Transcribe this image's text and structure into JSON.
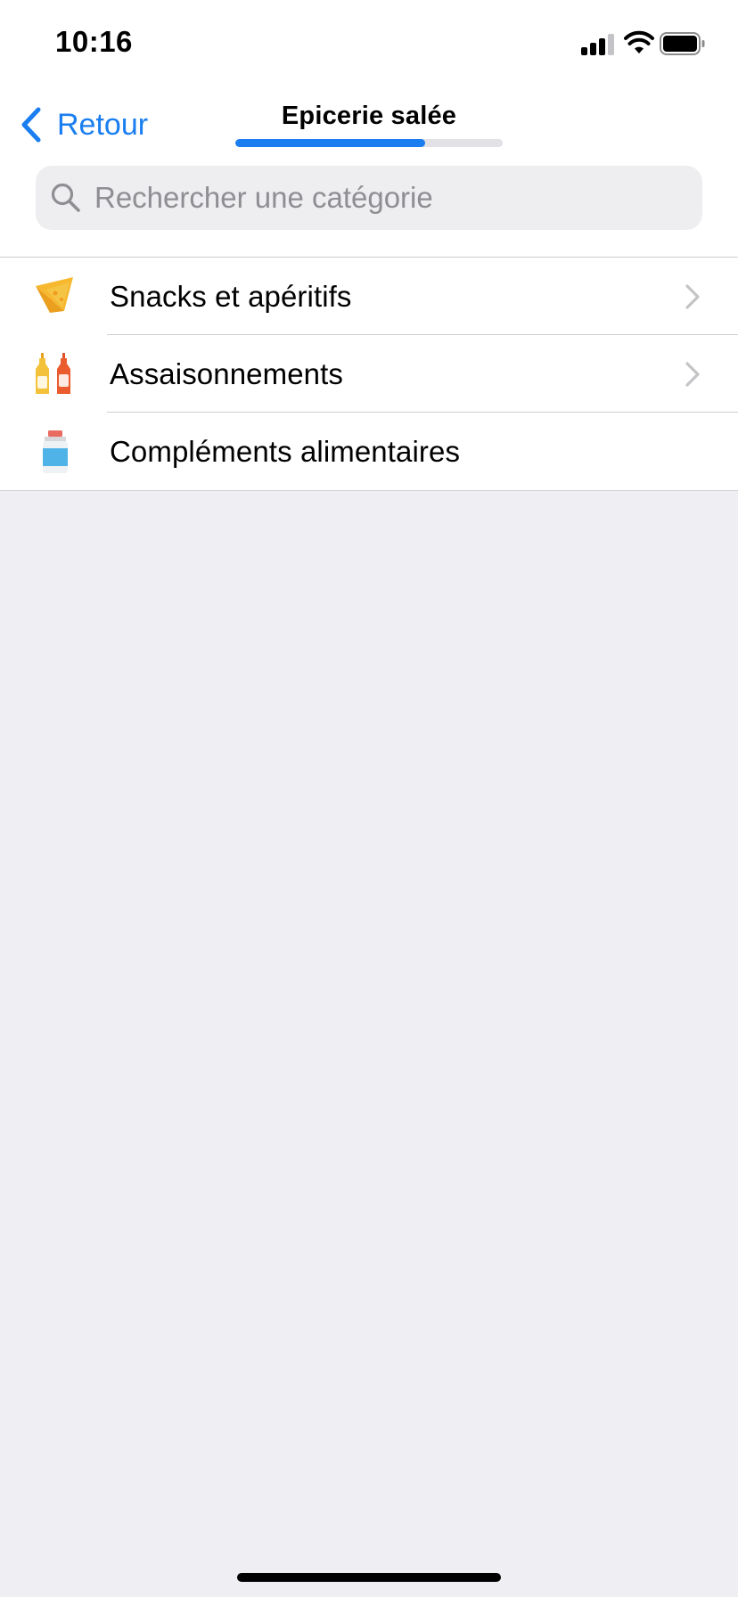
{
  "status_bar": {
    "time": "10:16",
    "icons": [
      "cellular-signal-icon",
      "wifi-icon",
      "battery-icon"
    ]
  },
  "nav": {
    "back_label": "Retour",
    "back_icon": "chevron-left-icon",
    "title": "Epicerie salée",
    "progress_fraction": 0.71
  },
  "search": {
    "placeholder": "Rechercher une catégorie",
    "value": "",
    "icon": "magnifying-glass-icon"
  },
  "categories": [
    {
      "label": "Snacks et apéritifs",
      "icon": "nacho-chip-icon",
      "has_chevron": true
    },
    {
      "label": "Assaisonnements",
      "icon": "condiment-bottles-icon",
      "has_chevron": true
    },
    {
      "label": "Compléments alimentaires",
      "icon": "supplement-bottle-icon",
      "has_chevron": false
    }
  ],
  "colors": {
    "accent": "#1a7ef0",
    "background": "#eeeef3",
    "separator": "#cfcfd3",
    "placeholder": "#8e8e93"
  }
}
